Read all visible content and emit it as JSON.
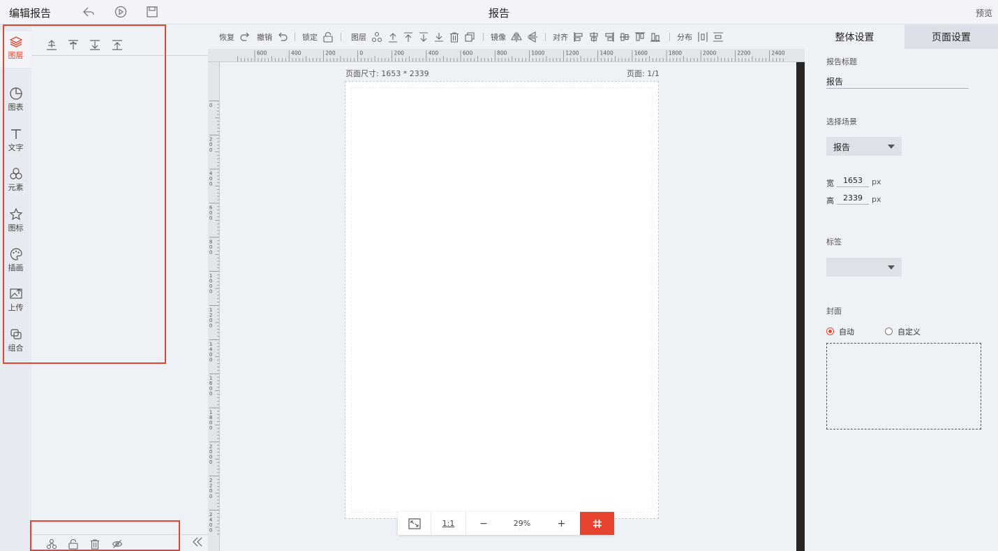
{
  "header": {
    "app_title": "编辑报告",
    "doc_title": "报告",
    "preview_label": "预览"
  },
  "left_nav": {
    "items": [
      {
        "label": "图层",
        "icon": "layers-icon",
        "active": true
      },
      {
        "label": "图表",
        "icon": "pie-chart-icon"
      },
      {
        "label": "文字",
        "icon": "text-icon"
      },
      {
        "label": "元素",
        "icon": "shapes-icon"
      },
      {
        "label": "图标",
        "icon": "star-icon"
      },
      {
        "label": "插画",
        "icon": "palette-icon"
      },
      {
        "label": "上传",
        "icon": "upload-image-icon"
      },
      {
        "label": "组合",
        "icon": "group-icon"
      }
    ]
  },
  "toolbar": {
    "redo_label": "恢复",
    "undo_label": "撤销",
    "lock_label": "锁定",
    "layer_label": "图层",
    "mirror_label": "镜像",
    "align_label": "对齐",
    "distribute_label": "分布"
  },
  "ruler": {
    "top_ticks": [
      "600",
      "400",
      "200",
      "0",
      "200",
      "400",
      "600",
      "800",
      "1000",
      "1200",
      "1400",
      "1600",
      "1800",
      "2000",
      "2200",
      "2400"
    ],
    "left_ticks": [
      "0",
      "200",
      "400",
      "600",
      "800",
      "1000",
      "1200",
      "1400",
      "1600",
      "1800",
      "2000",
      "2200",
      "2400"
    ]
  },
  "canvas": {
    "page_size_label": "页面尺寸: 1653 * 2339",
    "page_number_label": "页面: 1/1"
  },
  "zoom": {
    "ratio_label": "1:1",
    "minus": "−",
    "percent": "29%",
    "plus": "+"
  },
  "right_panel": {
    "tabs": [
      "整体设置",
      "页面设置"
    ],
    "title_label": "报告标题",
    "title_value": "报告",
    "scene_label": "选择场景",
    "scene_value": "报告",
    "width_label": "宽",
    "width_value": "1653",
    "height_label": "高",
    "height_value": "2339",
    "unit": "px",
    "tag_label": "标签",
    "tag_value": "",
    "cover_label": "封面",
    "cover_auto": "自动",
    "cover_custom": "自定义"
  },
  "colors": {
    "accent": "#e8432e",
    "panel_bg": "#eef1f6",
    "scrollbar": "#262626"
  }
}
